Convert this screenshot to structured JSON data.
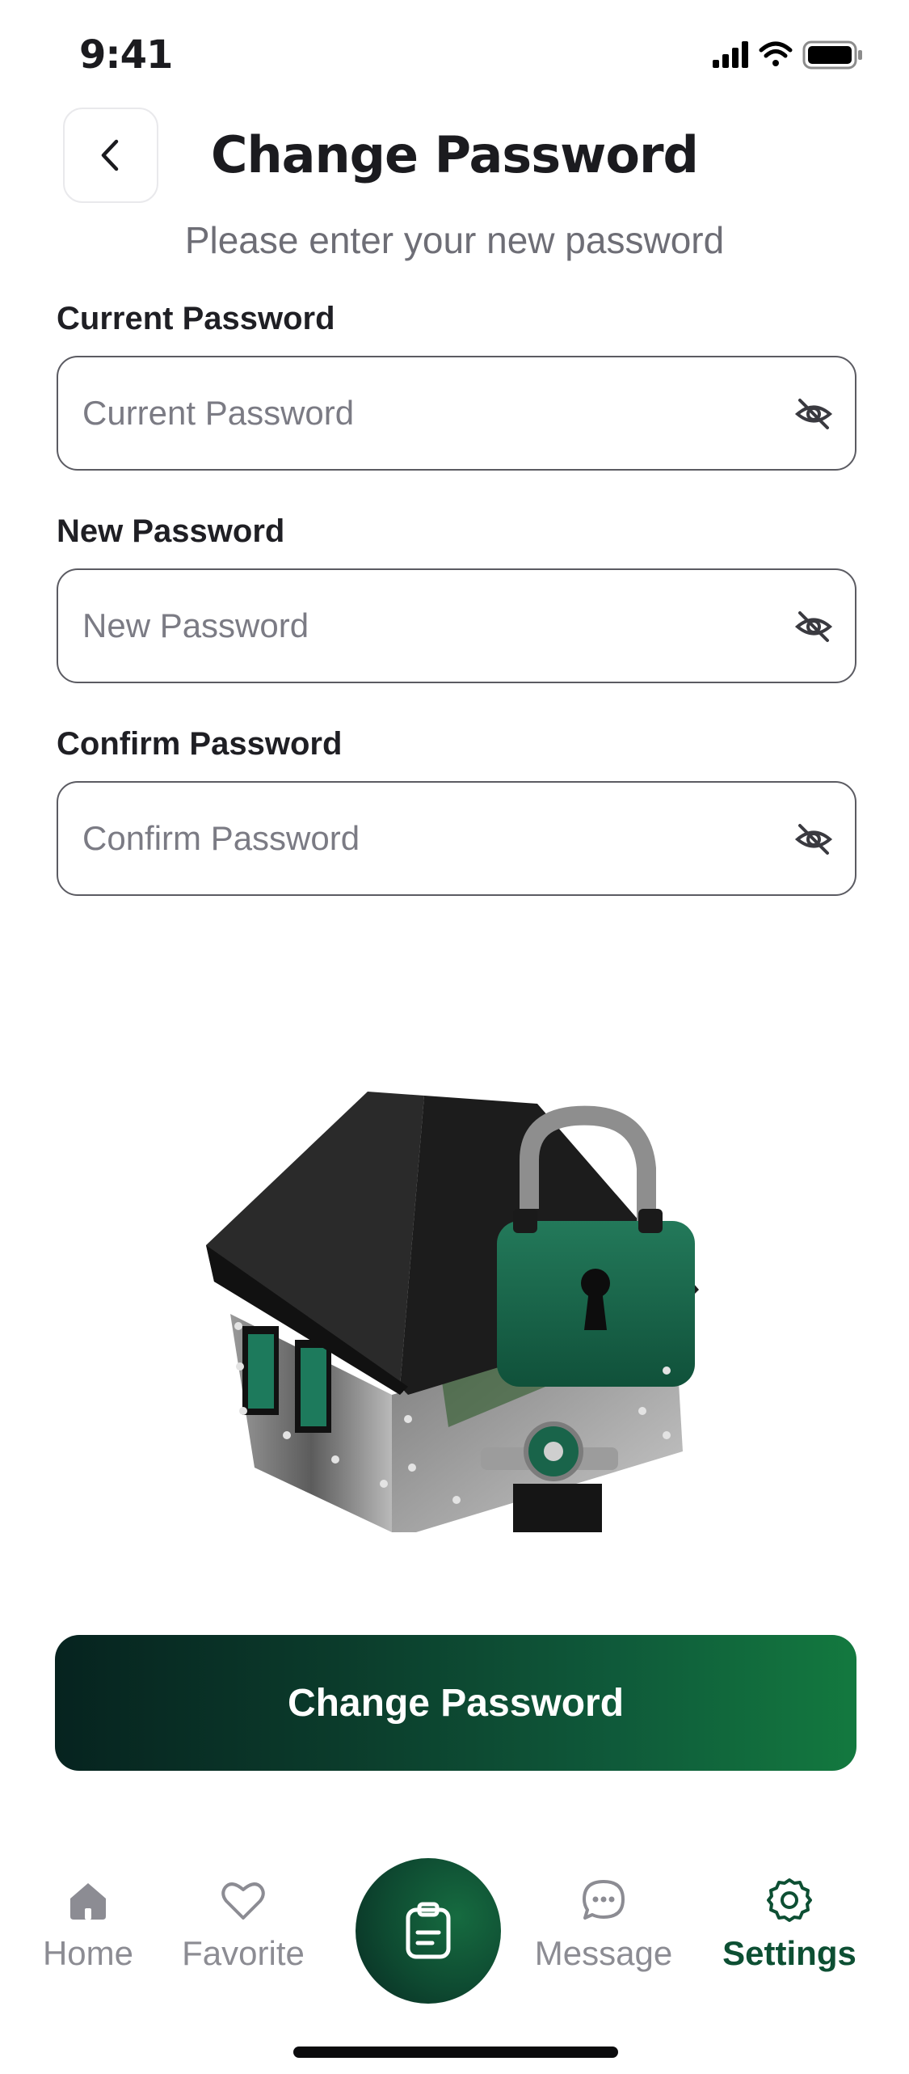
{
  "status_bar": {
    "time": "9:41",
    "icons": [
      "signal-icon",
      "wifi-icon",
      "battery-icon"
    ]
  },
  "header": {
    "title": "Change Password",
    "back_icon": "chevron-left-icon"
  },
  "subtitle": "Please enter your new password",
  "form": {
    "current": {
      "label": "Current Password",
      "placeholder": "Current Password",
      "value": ""
    },
    "new": {
      "label": "New Password",
      "placeholder": "New Password",
      "value": ""
    },
    "confirm": {
      "label": "Confirm Password",
      "placeholder": "Confirm Password",
      "value": ""
    }
  },
  "submit_label": "Change Password",
  "nav": {
    "items": [
      {
        "label": "Home",
        "icon": "home-icon"
      },
      {
        "label": "Favorite",
        "icon": "heart-icon"
      },
      {
        "label": "",
        "icon": "clipboard-icon"
      },
      {
        "label": "Message",
        "icon": "chat-bubble-icon"
      },
      {
        "label": "Settings",
        "icon": "gear-icon"
      }
    ],
    "active": "Settings"
  },
  "colors": {
    "accent": "#0d4f33",
    "gradient_start": "#06231f",
    "gradient_end": "#13793f",
    "muted": "#8c8c93"
  }
}
